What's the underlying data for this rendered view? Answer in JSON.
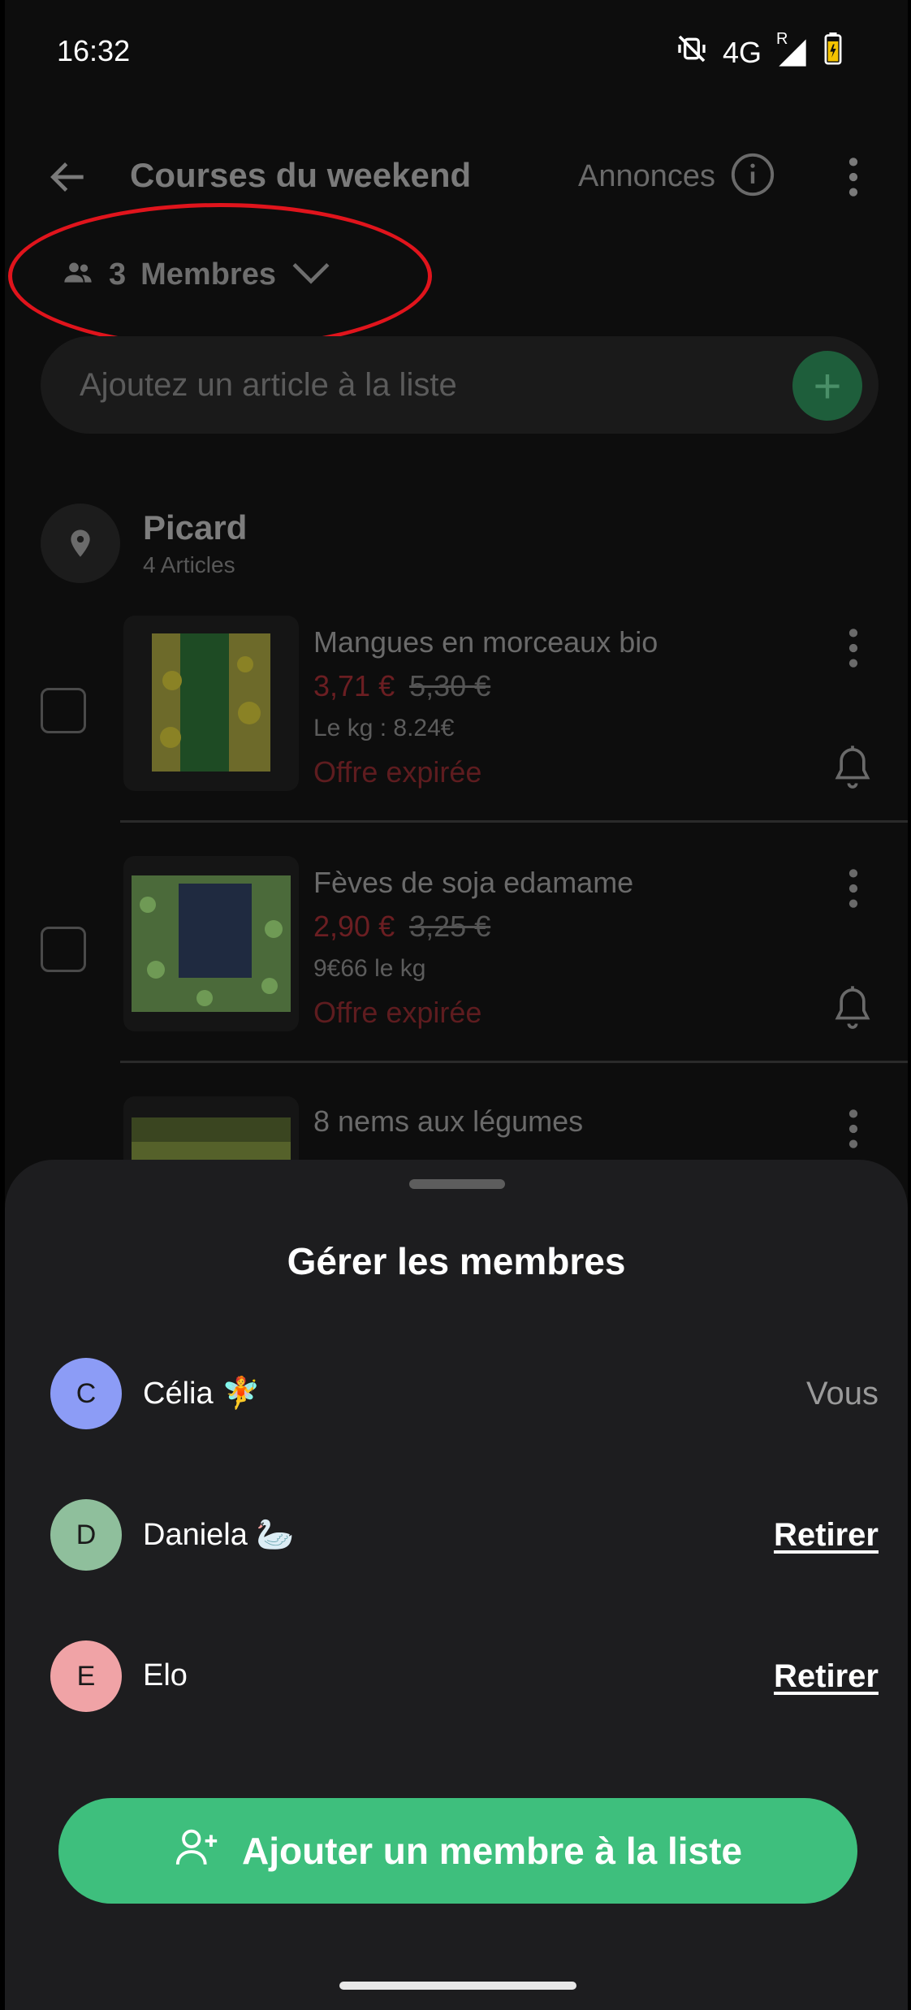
{
  "status_bar": {
    "time": "16:32",
    "network": "4G",
    "roaming": "R"
  },
  "header": {
    "title": "Courses du weekend",
    "ads_label": "Annonces"
  },
  "members_toggle": {
    "count": "3",
    "label": "Membres"
  },
  "add_item": {
    "placeholder": "Ajoutez un article à la liste"
  },
  "store": {
    "name": "Picard",
    "count": "4 Articles"
  },
  "items": [
    {
      "name": "Mangues en morceaux bio",
      "price": "3,71 €",
      "old_price": "5,30 €",
      "unit": "Le kg : 8.24€",
      "status": "Offre expirée"
    },
    {
      "name": "Fèves de soja edamame",
      "price": "2,90 €",
      "old_price": "3,25 €",
      "unit": "9€66 le kg",
      "status": "Offre expirée"
    },
    {
      "name": "8 nems aux légumes"
    }
  ],
  "sheet": {
    "title": "Gérer les membres",
    "members": [
      {
        "initial": "C",
        "name": "Célia 🧚",
        "action": "Vous",
        "color": "#8c9cf6"
      },
      {
        "initial": "D",
        "name": "Daniela 🦢",
        "action": "Retirer",
        "color": "#8fbf9c"
      },
      {
        "initial": "E",
        "name": "Elo",
        "action": "Retirer",
        "color": "#f0a3a6"
      }
    ],
    "add_button_label": "Ajouter un membre à la liste"
  },
  "colors": {
    "accent": "#3ebf7d",
    "highlight": "#e0141c"
  }
}
